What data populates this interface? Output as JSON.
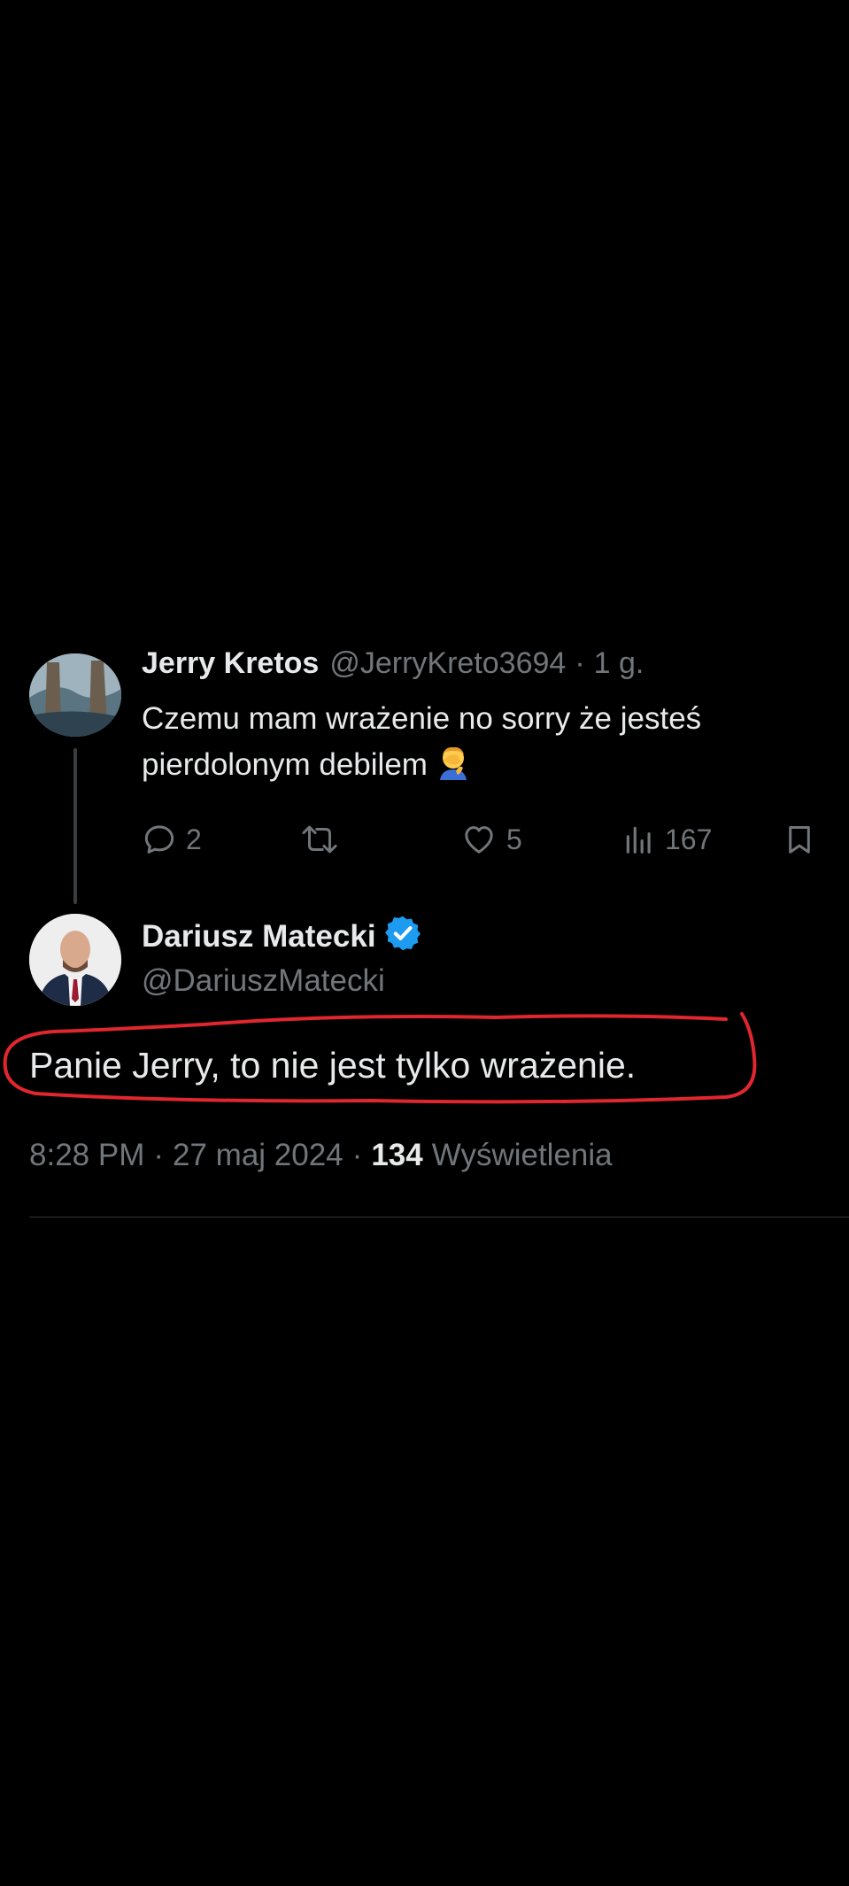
{
  "parent_tweet": {
    "display_name": "Jerry Kretos",
    "handle": "@JerryKreto3694",
    "separator": "·",
    "time": "1 g.",
    "text_line_1": "Czemu mam wrażenie no sorry że jesteś",
    "text_line_2": "pierdolonym debilem",
    "emoji": "facepalm-emoji",
    "actions": {
      "replies": "2",
      "retweets": "",
      "likes": "5",
      "views": "167"
    }
  },
  "main_tweet": {
    "display_name": "Dariusz Matecki",
    "verified": true,
    "handle": "@DariuszMatecki",
    "text": "Panie Jerry, to nie jest tylko wrażenie.",
    "time": "8:28 PM",
    "separator": "·",
    "date": "27 maj 2024",
    "views_count": "134",
    "views_label": "Wyświetlenia"
  },
  "colors": {
    "background": "#000000",
    "primary_text": "#e7e9ea",
    "secondary_text": "#71767b",
    "verified_badge": "#1d9bf0",
    "annotation_ring": "#e0262e",
    "divider": "#2f3336"
  }
}
